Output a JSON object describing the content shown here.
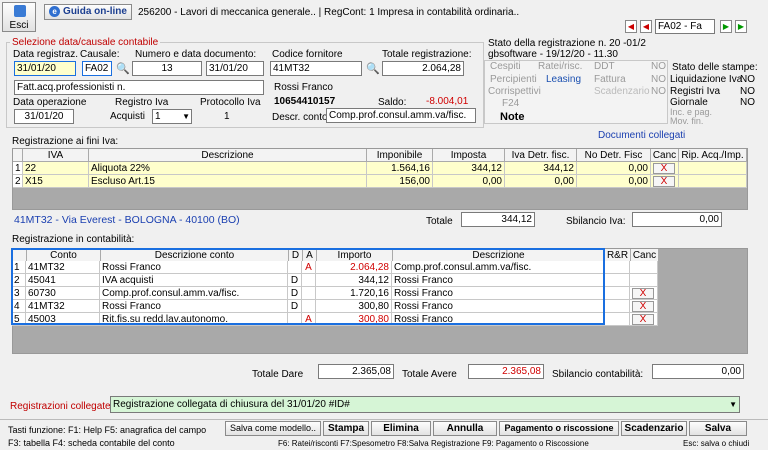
{
  "toolbar": {
    "esci_label": "Esci",
    "guida_label": "Guida on-line",
    "info": "256200 - Lavori di meccanica generale..  | RegCont: 1 Impresa  in contabilità ordinaria..",
    "nav_code": "FA02 - Fa"
  },
  "selection": {
    "legend": "Selezione data/causale contabile",
    "data_reg_label": "Data registraz.",
    "data_reg": "31/01/20",
    "causale_label": "Causale:",
    "causale": "FA02",
    "numdata_label": "Numero e data documento:",
    "numero": "13",
    "data_doc": "31/01/20",
    "descr_causale": "Fatt.acq.professionisti n.",
    "codfor_label": "Codice fornitore",
    "codfor": "41MT32",
    "totreg_label": "Totale registrazione:",
    "totreg": "2.064,28",
    "fornitore_nome": "Rossi Franco",
    "piva": "10654410157",
    "saldo_label": "Saldo:",
    "saldo": "-8.004,01",
    "dataop_label": "Data operazione",
    "dataop": "31/01/20",
    "regiva_label": "Registro Iva",
    "regiva_type": "Acquisti",
    "regiva_num": "1",
    "protiva_label": "Protocollo Iva",
    "protiva": "1",
    "descrconto_label": "Descr. conto",
    "descrconto": "Comp.prof.consul.amm.va/fisc."
  },
  "stato": {
    "title": "Stato della registrazione n. 20   -01/2",
    "user": "gbsoftware - 19/12/20    - 11.30",
    "rows": [
      [
        "Cespiti",
        "Ratei/risc.",
        "DDT",
        "NO"
      ],
      [
        "Percipienti",
        "Leasing",
        "Fattura",
        "NO"
      ],
      [
        "Corrispettivi",
        "",
        "Scadenzario",
        "NO"
      ],
      [
        "F24",
        "",
        "",
        ""
      ]
    ],
    "note": "Note",
    "stampe_title": "Stato delle stampe:",
    "stampe": [
      [
        "Liquidazione Iva",
        "NO"
      ],
      [
        "Registri Iva",
        "NO"
      ],
      [
        "Giornale",
        "NO"
      ],
      [
        "Inc. e pag.",
        ""
      ],
      [
        "Mov. fin.",
        ""
      ]
    ]
  },
  "iva": {
    "title": "Registrazione ai fini Iva:",
    "collegati": "Documenti collegati",
    "headers": [
      "IVA",
      "Descrizione",
      "Imponibile",
      "Imposta",
      "Iva Detr. fisc.",
      "No Detr. Fisc",
      "Canc",
      "Rip. Acq./Imp."
    ],
    "rows": [
      {
        "n": "1",
        "iva": "22",
        "descr": "Aliquota 22%",
        "imponibile": "1.564,16",
        "imposta": "344,12",
        "detr": "344,12",
        "nodetr": "0,00",
        "canc": "X"
      },
      {
        "n": "2",
        "iva": "X15",
        "descr": "Escluso Art.15",
        "imponibile": "156,00",
        "imposta": "0,00",
        "detr": "0,00",
        "nodetr": "0,00",
        "canc": "X"
      }
    ],
    "address": "41MT32 - Via Everest - BOLOGNA - 40100 (BO)",
    "totale_label": "Totale",
    "totale": "344,12",
    "sbil_label": "Sbilancio Iva:",
    "sbil": "0,00"
  },
  "cont": {
    "title": "Registrazione in contabilità:",
    "headers": [
      "Conto",
      "Descrizione conto",
      "D",
      "A",
      "Importo",
      "Descrizione",
      "R&R",
      "Canc"
    ],
    "rows": [
      {
        "n": "1",
        "conto": "41MT32",
        "descr": "Rossi Franco",
        "d": "",
        "a": "A",
        "importo": "2.064,28",
        "desc2": "Comp.prof.consul.amm.va/fisc.",
        "canc": ""
      },
      {
        "n": "2",
        "conto": "45041",
        "descr": "IVA acquisti",
        "d": "D",
        "a": "",
        "importo": "344,12",
        "desc2": "Rossi Franco",
        "canc": ""
      },
      {
        "n": "3",
        "conto": "60730",
        "descr": "Comp.prof.consul.amm.va/fisc.",
        "d": "D",
        "a": "",
        "importo": "1.720,16",
        "desc2": "Rossi Franco",
        "canc": "X"
      },
      {
        "n": "4",
        "conto": "41MT32",
        "descr": "Rossi Franco",
        "d": "D",
        "a": "",
        "importo": "300,80",
        "desc2": "Rossi Franco",
        "canc": "X"
      },
      {
        "n": "5",
        "conto": "45003",
        "descr": "Rit.fis.su redd.lav.autonomo.",
        "d": "",
        "a": "A",
        "importo": "300,80",
        "desc2": "Rossi Franco",
        "canc": "X"
      }
    ],
    "tot_dare_label": "Totale Dare",
    "tot_dare": "2.365,08",
    "tot_avere_label": "Totale Avere",
    "tot_avere": "2.365,08",
    "sbil_label": "Sbilancio contabilità:",
    "sbil": "0,00"
  },
  "collegate": {
    "label": "Registrazioni collegate:",
    "value": "Registrazione collegata di chiusura del 31/01/20    #ID#"
  },
  "footer": {
    "tasti": "Tasti funzione:  F1: Help  F5: anagrafica del campo",
    "tasti2": "F3: tabella   F4: scheda contabile del conto",
    "salva_modello": "Salva come modello..",
    "stampa": "Stampa",
    "elimina": "Elimina",
    "annulla": "Annulla",
    "pagamento": "Pagamento o riscossione",
    "scadenzario": "Scadenzario",
    "salva": "Salva",
    "hints": "F6: Ratei/risconti   F7:Spesometro    F8:Salva Registrazione     F9: Pagamento o Riscossione",
    "esc": "Esc: salva o chiudi"
  }
}
